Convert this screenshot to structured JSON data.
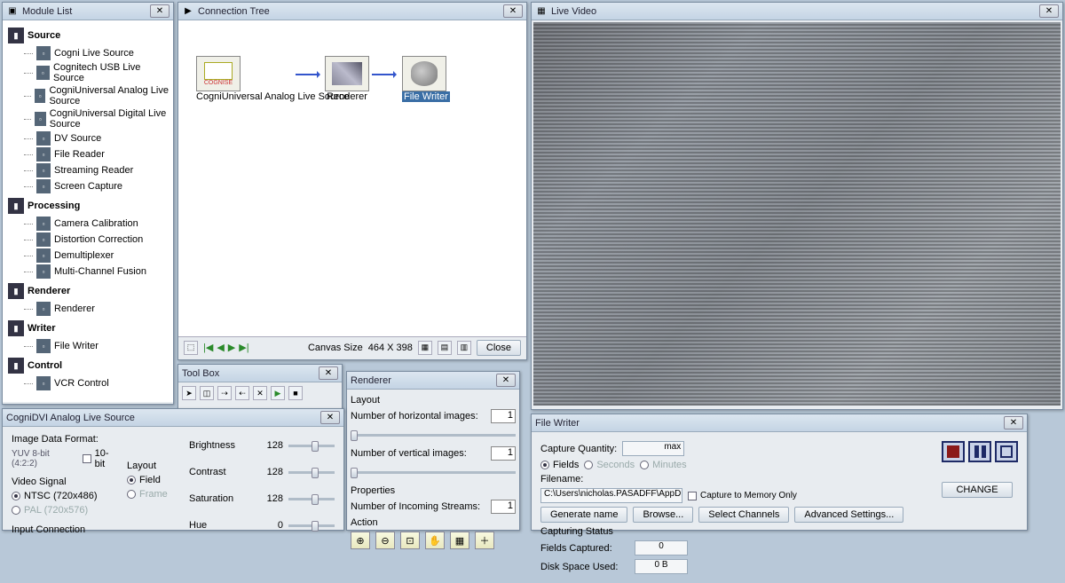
{
  "moduleList": {
    "title": "Module List",
    "groups": [
      {
        "label": "Source",
        "items": [
          "Cogni Live Source",
          "Cognitech USB  Live Source",
          "CogniUniversal Analog Live Source",
          "CogniUniversal Digital Live Source",
          "DV Source",
          "File Reader",
          "Streaming Reader",
          "Screen Capture"
        ]
      },
      {
        "label": "Processing",
        "items": [
          "Camera Calibration",
          "Distortion Correction",
          "Demultiplexer",
          "Multi-Channel Fusion"
        ]
      },
      {
        "label": "Renderer",
        "items": [
          "Renderer"
        ]
      },
      {
        "label": "Writer",
        "items": [
          "File Writer"
        ]
      },
      {
        "label": "Control",
        "items": [
          "VCR Control"
        ]
      }
    ]
  },
  "connectionTree": {
    "title": "Connection Tree",
    "nodes": [
      {
        "label": "CogniUniversal Analog Live Source"
      },
      {
        "label": "Renderer"
      },
      {
        "label": "File Writer",
        "selected": true
      }
    ],
    "canvasSizeLabel": "Canvas Size",
    "canvasSize": "464 X 398",
    "closeLabel": "Close"
  },
  "toolBox": {
    "title": "Tool Box"
  },
  "liveVideo": {
    "title": "Live Video"
  },
  "renderer": {
    "title": "Renderer",
    "layoutLabel": "Layout",
    "hLabel": "Number of horizontal images:",
    "hValue": "1",
    "vLabel": "Number of vertical images:",
    "vValue": "1",
    "propertiesLabel": "Properties",
    "streamsLabel": "Number of Incoming Streams:",
    "streamsValue": "1",
    "actionLabel": "Action"
  },
  "dvi": {
    "title": "CogniDVI Analog Live Source",
    "imageDataFormatLabel": "Image Data Format:",
    "pixelFormat": "YUV 8-bit (4:2:2)",
    "tenBitLabel": "10-bit",
    "videoSignalLabel": "Video Signal",
    "ntscLabel": "NTSC (720x486)",
    "palLabel": "PAL (720x576)",
    "layoutLabel": "Layout",
    "fieldLabel": "Field",
    "frameLabel": "Frame",
    "inputConnectionLabel": "Input Connection",
    "brightnessLabel": "Brightness",
    "brightnessValue": "128",
    "contrastLabel": "Contrast",
    "contrastValue": "128",
    "saturationLabel": "Saturation",
    "saturationValue": "128",
    "hueLabel": "Hue",
    "hueValue": "0"
  },
  "fileWriter": {
    "title": "File Writer",
    "captureQtyLabel": "Capture Quantity:",
    "maxLabel": "max",
    "fieldsLabel": "Fields",
    "secondsLabel": "Seconds",
    "minutesLabel": "Minutes",
    "filenameLabel": "Filename:",
    "filenameValue": "C:\\Users\\nicholas.PASADFF\\AppD",
    "generateLabel": "Generate name",
    "browseLabel": "Browse...",
    "captureMemLabel": "Capture to Memory Only",
    "selectChannelsLabel": "Select Channels",
    "advancedLabel": "Advanced Settings...",
    "changeLabel": "CHANGE",
    "statusLabel": "Capturing Status",
    "fieldsCapturedLabel": "Fields Captured:",
    "fieldsCapturedValue": "0",
    "diskSpaceLabel": "Disk Space Used:",
    "diskSpaceValue": "0 B"
  }
}
